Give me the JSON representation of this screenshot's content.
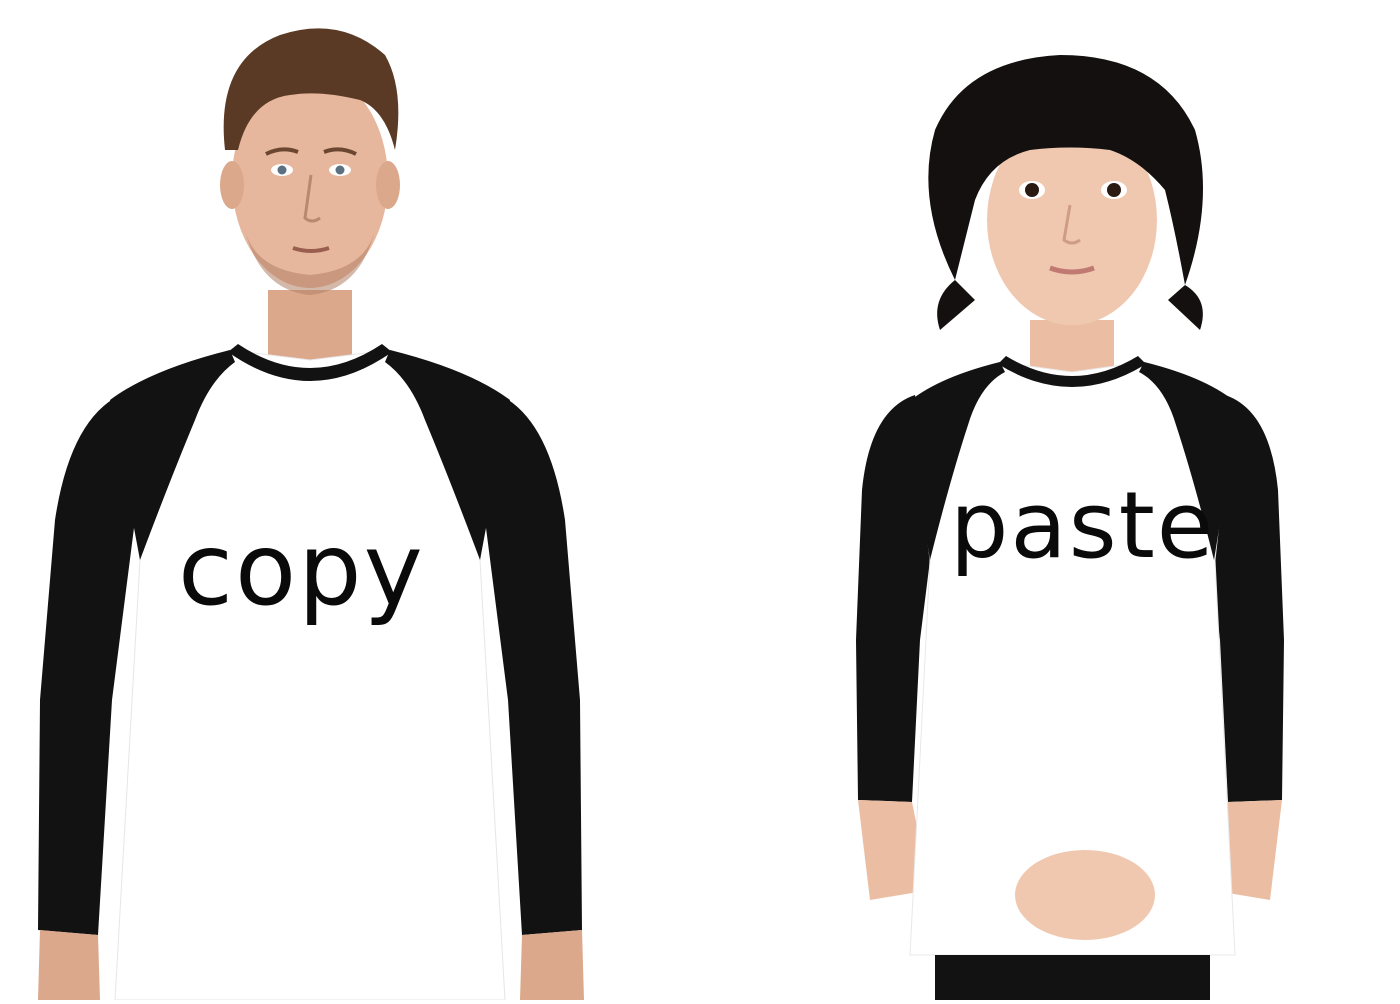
{
  "photo": {
    "background_color": "#ffffff",
    "shirt_body_color": "#ffffff",
    "shirt_sleeve_color": "#101010",
    "skin_color_adult": "#e6b79d",
    "skin_color_child": "#f0c8b0",
    "hair_color_adult": "#5a3a24",
    "hair_color_child": "#141010"
  },
  "adult": {
    "shirt_text": "copy"
  },
  "child": {
    "shirt_text": "paste"
  }
}
